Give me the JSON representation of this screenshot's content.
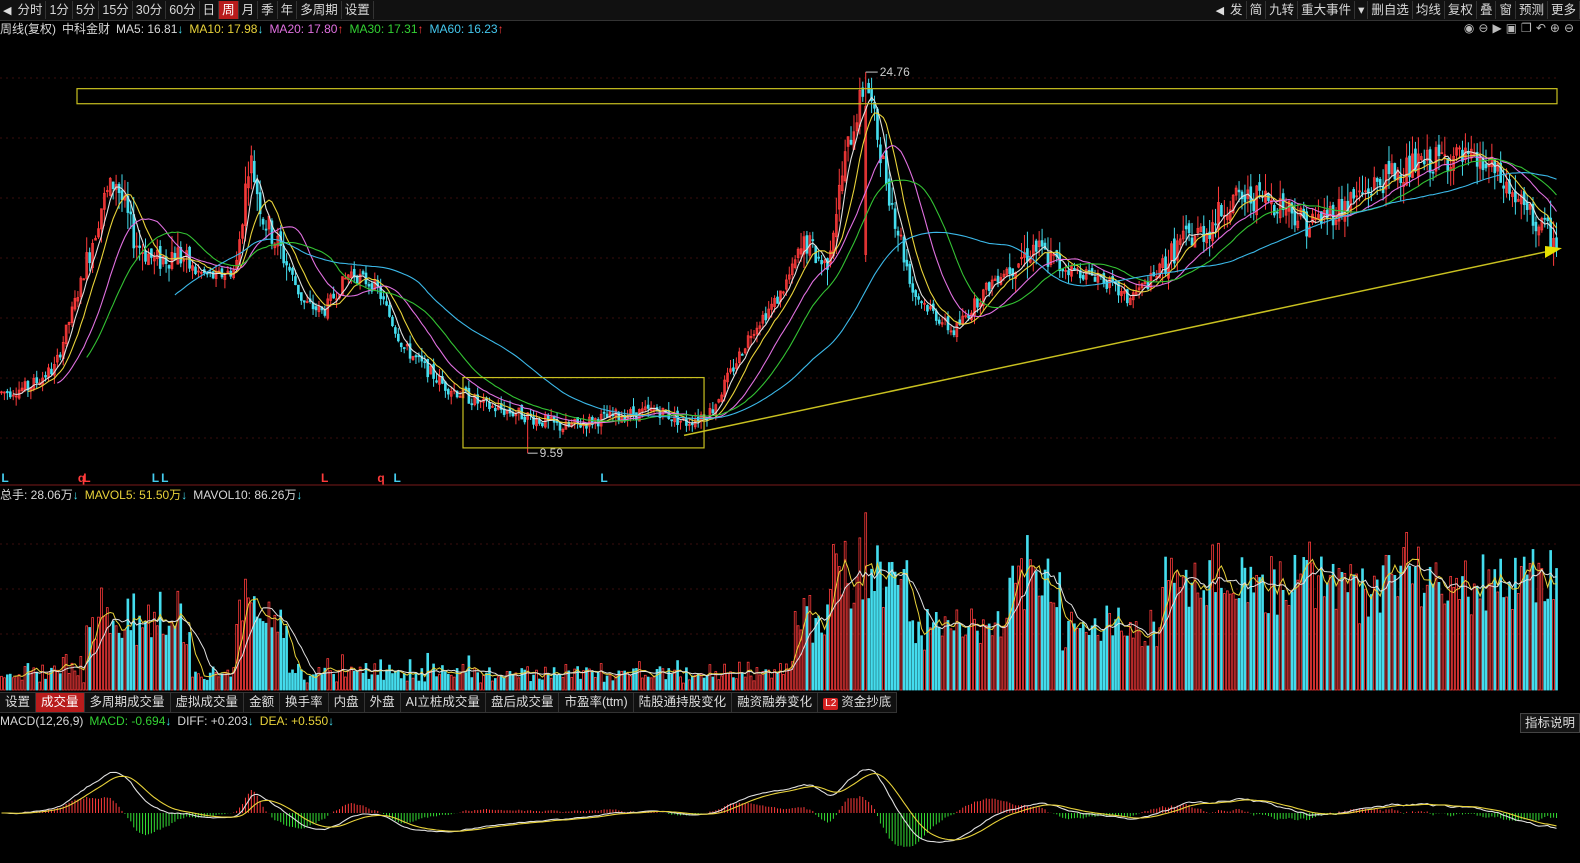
{
  "toolbar": {
    "left": [
      "分时",
      "1分",
      "5分",
      "15分",
      "30分",
      "60分",
      "日",
      "周",
      "月",
      "季",
      "年",
      "多周期",
      "设置"
    ],
    "active": "周",
    "right": [
      "发",
      "简",
      "九转",
      "重大事件",
      "▾",
      "删自选",
      "均线",
      "复权",
      "叠",
      "窗",
      "预测",
      "更多"
    ]
  },
  "main_info": {
    "period": "周线(复权)",
    "name": "中科金财",
    "ma5": "MA5: 16.81",
    "ma10": "MA10: 17.98",
    "ma20": "MA20: 17.80",
    "ma30": "MA30: 17.31",
    "ma60": "MA60: 16.23",
    "arrow_dn": "↓",
    "arrow_up": "↑"
  },
  "vol_info": {
    "total": "总手: 28.06万",
    "mavol5": "MAVOL5: 51.50万",
    "mavol10": "MAVOL10: 86.26万",
    "arrow_dn": "↓"
  },
  "macd_info": {
    "label": "MACD(12,26,9)",
    "macd": "MACD: -0.694",
    "diff": "DIFF: +0.203",
    "dea": "DEA: +0.550",
    "arrow_dn": "↓",
    "arrow_up": "↑"
  },
  "tabs": [
    "设置",
    "成交量",
    "多周期成交量",
    "虚拟成交量",
    "金额",
    "换手率",
    "内盘",
    "外盘",
    "AI立桩成交量",
    "盘后成交量",
    "市盈率(ttm)",
    "陆股通持股变化",
    "融资融券变化",
    "资金抄底"
  ],
  "active_tab": "成交量",
  "l2_badge": "L2",
  "help_button": "指标说明",
  "icons": [
    "eye-icon",
    "circle-minus-icon",
    "play-icon",
    "lock-icon",
    "copy-icon",
    "undo-icon",
    "plus-icon",
    "minus-icon"
  ],
  "chart_data": {
    "type": "candlestick",
    "high_label": "24.76",
    "low_label": "9.59",
    "signal_markers": [
      {
        "i": 1,
        "label": "L",
        "color": "#44ccee"
      },
      {
        "i": 58,
        "label": "q",
        "color": "#ff3b3b"
      },
      {
        "i": 62,
        "label": "L",
        "color": "#ff3b3b"
      },
      {
        "i": 113,
        "label": "L",
        "color": "#44ccee"
      },
      {
        "i": 120,
        "label": "L",
        "color": "#44ccee"
      },
      {
        "i": 239,
        "label": "L",
        "color": "#ff3b3b"
      },
      {
        "i": 281,
        "label": "q",
        "color": "#ff3b3b"
      },
      {
        "i": 293,
        "label": "L",
        "color": "#44ccee"
      },
      {
        "i": 447,
        "label": "L",
        "color": "#44ccee"
      }
    ],
    "colors": {
      "up": "#ff3b3b",
      "down": "#44ddee",
      "ma5": "#e0e0e0",
      "ma10": "#e8d23a",
      "ma20": "#e070e0",
      "ma30": "#33c233",
      "ma60": "#3bb8e8",
      "box": "#c8c020"
    }
  }
}
